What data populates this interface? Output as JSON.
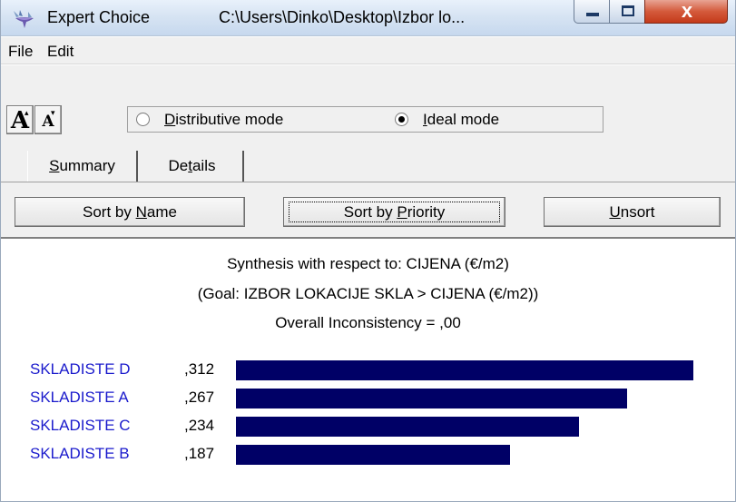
{
  "window": {
    "app_name": "Expert Choice",
    "path": "C:\\Users\\Dinko\\Desktop\\Izbor lo...",
    "close_symbol": "x"
  },
  "menu": {
    "items": [
      "File",
      "Edit"
    ]
  },
  "toolbar": {
    "font_larger_label": "A",
    "font_smaller_label": "A",
    "mode_distributive_label_accesskey": "D",
    "mode_distributive_label_rest": "istributive mode",
    "mode_ideal_label_accesskey": "I",
    "mode_ideal_label_rest": "deal mode",
    "selected_mode": "Ideal mode"
  },
  "tabs": {
    "summary_accesskey": "S",
    "summary_rest": "ummary",
    "details_before": "De",
    "details_accesskey": "t",
    "details_after": "ails",
    "active": "Summary"
  },
  "buttons": {
    "sort_name_before": "Sort by ",
    "sort_name_accesskey": "N",
    "sort_name_after": "ame",
    "sort_priority_before": "Sort by ",
    "sort_priority_accesskey": "P",
    "sort_priority_after": "riority",
    "unsort_accesskey": "U",
    "unsort_rest": "nsort"
  },
  "synthesis": {
    "line1": "Synthesis with respect to: CIJENA (€/m2)",
    "line2": "(Goal: IZBOR LOKACIJE SKLA > CIJENA (€/m2))",
    "line3": "Overall Inconsistency = ,00"
  },
  "results": [
    {
      "name": "SKLADISTE D",
      "value_label": ",312",
      "value": 0.312
    },
    {
      "name": "SKLADISTE A",
      "value_label": ",267",
      "value": 0.267
    },
    {
      "name": "SKLADISTE C",
      "value_label": ",234",
      "value": 0.234
    },
    {
      "name": "SKLADISTE B",
      "value_label": ",187",
      "value": 0.187
    }
  ],
  "colors": {
    "bar": "#000066",
    "alternative_name": "#1a1acc"
  },
  "icons": {
    "app": "expert-choice-logo-icon",
    "minimize": "minimize-icon",
    "maximize": "maximize-icon",
    "close": "close-icon"
  }
}
